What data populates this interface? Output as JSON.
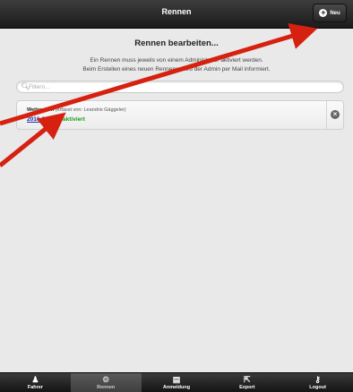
{
  "header": {
    "title": "Rennen",
    "new_label": "Neu",
    "plus_icon": "plus-icon"
  },
  "main": {
    "heading": "Rennen bearbeiten...",
    "info_line1": "Ein Rennen muss jeweils von einem Administrator aktiviert werden.",
    "info_line2": "Beim Erstellen eines neuen Rennens, wird der Admin per Mail informiert."
  },
  "filter": {
    "placeholder": "Filtern...",
    "icon": "search-icon"
  },
  "races": [
    {
      "title": "Wettrennen",
      "author": "(erfasst von: Leandris Gäggeler)",
      "date": "2016-02-20",
      "status": "aktiviert",
      "delete_icon": "close-circle-icon"
    }
  ],
  "tabs": [
    {
      "label": "Fahrer",
      "icon": "driver-icon"
    },
    {
      "label": "Rennen",
      "icon": "gear-icon"
    },
    {
      "label": "Anmeldung",
      "icon": "inbox-icon"
    },
    {
      "label": "Export",
      "icon": "export-icon"
    },
    {
      "label": "Logout",
      "icon": "key-icon"
    }
  ],
  "colors": {
    "arrow": "#d62010",
    "status_active": "#1aa01a",
    "date_link": "#1a2fa8"
  }
}
